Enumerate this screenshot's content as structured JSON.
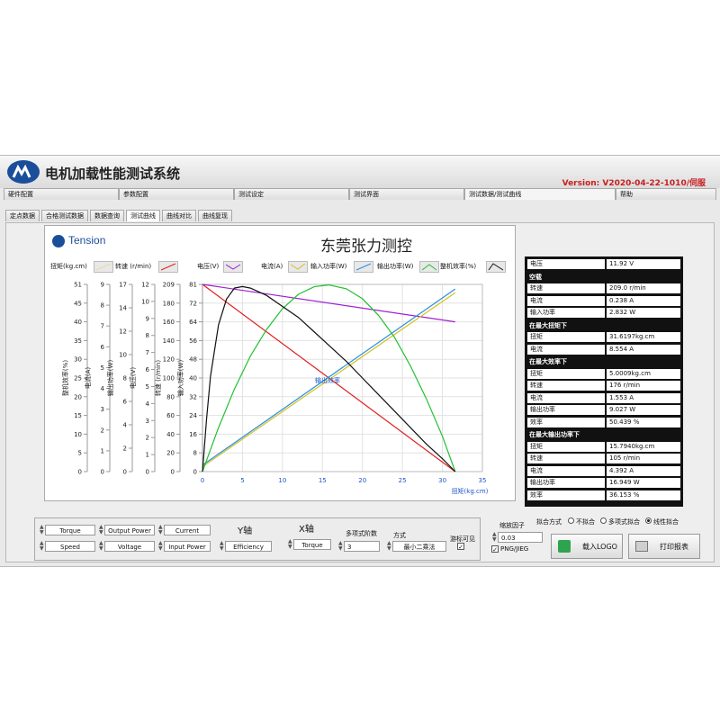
{
  "app": {
    "title": "电机加载性能测试系统",
    "version": "Version: V2020-04-22-1010/伺服"
  },
  "main_tabs": [
    {
      "label": "硬件配置"
    },
    {
      "label": "参数配置"
    },
    {
      "label": "测试设定"
    },
    {
      "label": "测试界面"
    },
    {
      "label": "测试数据/测试曲线",
      "active": true
    },
    {
      "label": "帮助"
    }
  ],
  "sub_tabs": [
    {
      "label": "定点数据"
    },
    {
      "label": "合格测试数据"
    },
    {
      "label": "数据查询"
    },
    {
      "label": "测试曲线",
      "active": true
    },
    {
      "label": "曲线对比"
    },
    {
      "label": "曲线复现"
    }
  ],
  "chart_header": {
    "logo_text": "Tension",
    "title": "东莞张力测控",
    "center_marker": "输出效率"
  },
  "legend": [
    {
      "name": "扭矩(kg.cm)",
      "color": "#e8d9a6"
    },
    {
      "name": "转速 (r/min)",
      "color": "#e02020"
    },
    {
      "name": "电压(V)",
      "color": "#a020d0"
    },
    {
      "name": "电流(A)",
      "color": "#d4c020"
    },
    {
      "name": "输入功率(W)",
      "color": "#2a8fe0"
    },
    {
      "name": "输出功率(W)",
      "color": "#20c030"
    },
    {
      "name": "整机效率(%)",
      "color": "#111111"
    }
  ],
  "chart_data": {
    "type": "line",
    "xlabel": "扭矩(kg.cm)",
    "xlim": [
      0,
      35
    ],
    "x_ticks": [
      0,
      5,
      10,
      15,
      20,
      25,
      30,
      35
    ],
    "y_axes": [
      {
        "label": "整机效率(%)",
        "ticks": [
          0,
          5,
          10,
          15,
          20,
          25,
          30,
          35,
          40,
          45,
          51
        ]
      },
      {
        "label": "电流(A)",
        "ticks": [
          0,
          1,
          2,
          3,
          4,
          5,
          6,
          7,
          8,
          9
        ]
      },
      {
        "label": "输出功率(W)",
        "ticks": [
          0,
          2,
          4,
          6,
          8,
          10,
          12,
          14,
          17
        ]
      },
      {
        "label": "电压(V)",
        "ticks": [
          0,
          1,
          2,
          3,
          4,
          5,
          6,
          7,
          8,
          9,
          10,
          12
        ]
      },
      {
        "label": "转速 (r/min)",
        "ticks": [
          0,
          20,
          40,
          60,
          80,
          100,
          120,
          140,
          160,
          180,
          209
        ]
      },
      {
        "label": "输入功率(W)",
        "ticks": [
          0,
          8,
          16,
          24,
          32,
          40,
          48,
          56,
          64,
          72,
          81
        ]
      }
    ],
    "series": [
      {
        "name": "转速 (r/min)",
        "color": "#e02020",
        "axis": 4,
        "x": [
          0,
          31.6
        ],
        "y": [
          209,
          0
        ]
      },
      {
        "name": "电压(V)",
        "color": "#a020d0",
        "axis": 3,
        "x": [
          0,
          31.6
        ],
        "y": [
          12,
          9.6
        ]
      },
      {
        "name": "电流(A)",
        "color": "#d4c020",
        "axis": 1,
        "x": [
          0,
          31.6
        ],
        "y": [
          0.24,
          8.6
        ]
      },
      {
        "name": "输入功率(W)",
        "color": "#2a8fe0",
        "axis": 5,
        "x": [
          0,
          31.6
        ],
        "y": [
          2.8,
          79
        ]
      },
      {
        "name": "输出功率(W)",
        "color": "#20c030",
        "axis": 2,
        "x": [
          0,
          2,
          4,
          6,
          8,
          10,
          12,
          14,
          15.8,
          18,
          20,
          22,
          24,
          26,
          28,
          30,
          31.6
        ],
        "y": [
          0,
          4.0,
          7.5,
          10.5,
          12.9,
          14.8,
          16.1,
          16.8,
          16.95,
          16.6,
          15.7,
          14.2,
          12.2,
          9.6,
          6.6,
          3.2,
          0
        ]
      },
      {
        "name": "整机效率(%)",
        "color": "#111111",
        "axis": 0,
        "x": [
          0,
          0.5,
          1,
          2,
          3,
          4,
          5,
          6,
          8,
          10,
          12,
          14,
          16,
          18,
          20,
          22,
          24,
          26,
          28,
          30,
          31.6
        ],
        "y": [
          0,
          14,
          26,
          40,
          47,
          50,
          50.4,
          50,
          48,
          45,
          42,
          38,
          34,
          30,
          25.5,
          21,
          16.5,
          12,
          7.5,
          3.5,
          0
        ]
      }
    ]
  },
  "info_panel": {
    "rows": [
      {
        "label": "电压",
        "value": "11.92 V"
      },
      {
        "section": "空载"
      },
      {
        "label": "转速",
        "value": "209.0 r/min"
      },
      {
        "label": "电流",
        "value": "0.238 A"
      },
      {
        "label": "输入功率",
        "value": "2.832 W"
      },
      {
        "section": "在最大扭矩下"
      },
      {
        "label": "扭矩",
        "value": "31.6197kg.cm"
      },
      {
        "label": "电流",
        "value": "8.554 A"
      },
      {
        "section": "在最大效率下"
      },
      {
        "label": "扭矩",
        "value": "5.0009kg.cm"
      },
      {
        "label": "转速",
        "value": "176  r/min"
      },
      {
        "label": "电流",
        "value": "1.553 A"
      },
      {
        "label": "输出功率",
        "value": "9.027 W"
      },
      {
        "label": "效率",
        "value": "50.439 %"
      },
      {
        "section": "在最大输出功率下"
      },
      {
        "label": "扭矩",
        "value": "15.7940kg.cm"
      },
      {
        "label": "转速",
        "value": "105  r/min"
      },
      {
        "label": "电流",
        "value": "4.392 A"
      },
      {
        "label": "输出功率",
        "value": "16.949 W"
      },
      {
        "label": "效率",
        "value": "36.153 %"
      }
    ]
  },
  "controls": {
    "selectors": [
      "Torque",
      "Output Power",
      "Current",
      "Speed",
      "Voltage",
      "Input Power",
      "Efficiency"
    ],
    "y_axis_label": "Y轴",
    "x_axis_label": "X轴",
    "x_axis_value": "Torque",
    "poly_order_label": "多项式阶数",
    "poly_order_value": "3",
    "method_label": "方式",
    "method_value": "最小二乘法",
    "cursor_label": "游标可见",
    "cursor_checked": true,
    "zoom_label": "缩放因子",
    "zoom_value": "0.03",
    "png_label": "PNG/JIEG",
    "png_checked": true,
    "fit_label": "拟合方式",
    "fit_options": [
      {
        "label": "不拟合",
        "selected": false
      },
      {
        "label": "多项式拟合",
        "selected": false
      },
      {
        "label": "线性拟合",
        "selected": true
      }
    ],
    "load_logo_label": "载入LOGO",
    "print_label": "打印报表"
  }
}
